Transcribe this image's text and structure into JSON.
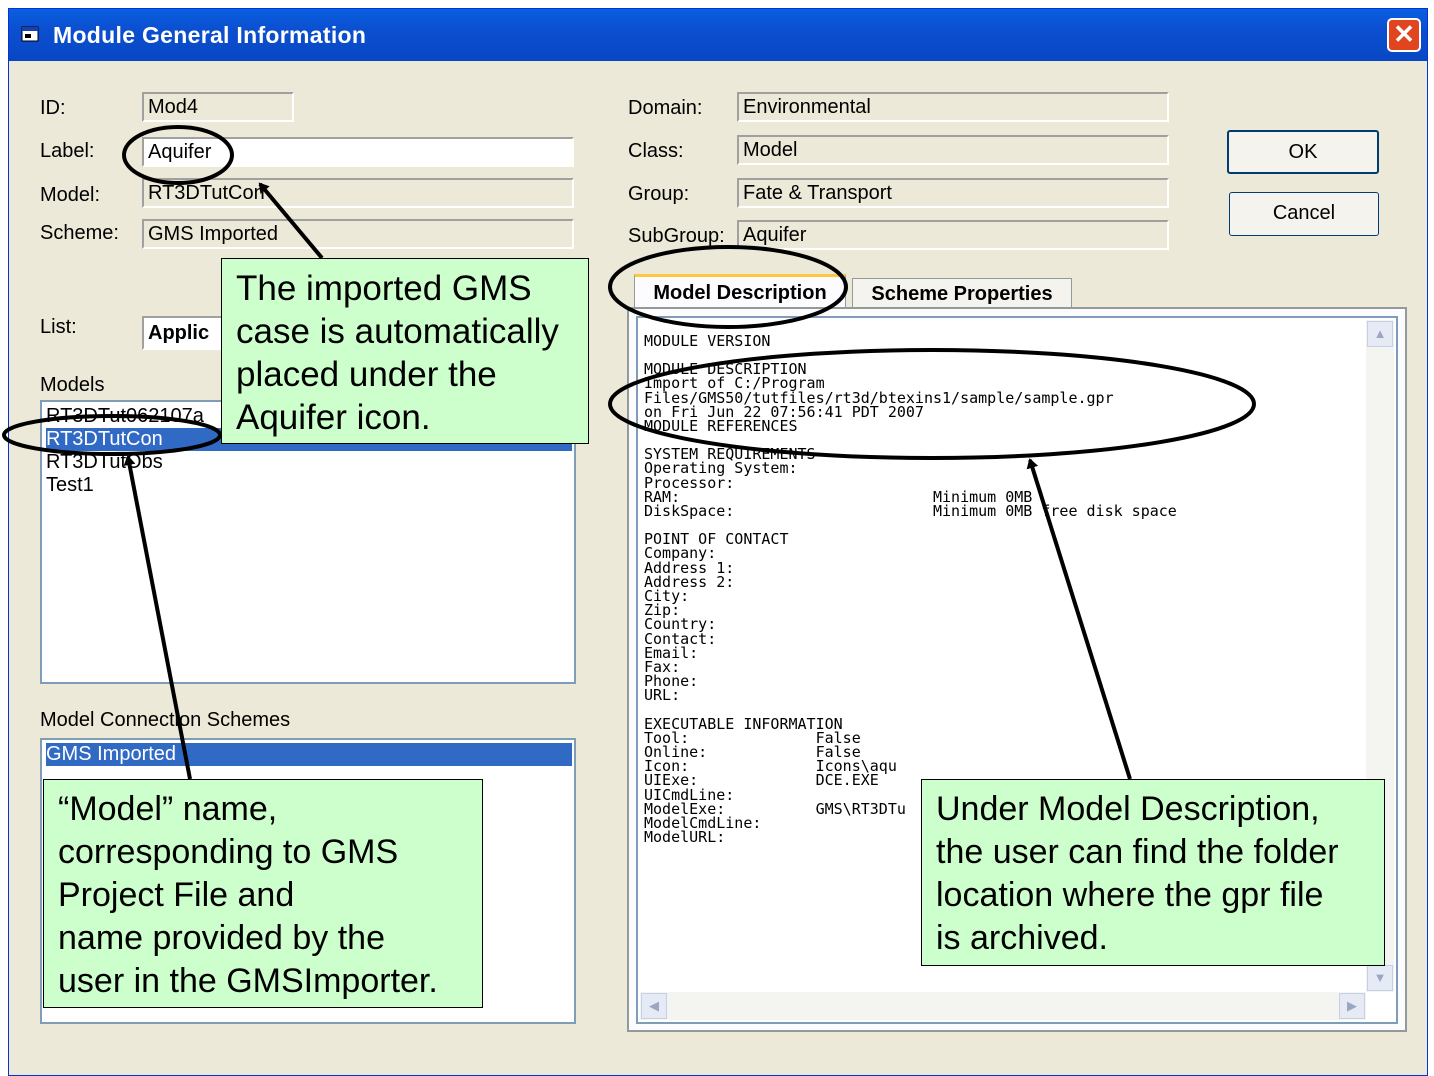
{
  "window": {
    "title": "Module General Information",
    "close_glyph": "✕"
  },
  "left_fields": [
    {
      "label": "ID:",
      "value": "Mod4"
    },
    {
      "label": "Label:",
      "value": "Aquifer"
    },
    {
      "label": "Model:",
      "value": "RT3DTutCon"
    },
    {
      "label": "Scheme:",
      "value": "GMS Imported"
    }
  ],
  "list": {
    "label": "List:",
    "value": "Applic"
  },
  "models": {
    "label": "Models",
    "items": [
      "RT3DTut062107a",
      "RT3DTutCon",
      "RT3DTutObs",
      "Test1"
    ],
    "selected_index": 1
  },
  "schemes": {
    "label": "Model Connection Schemes",
    "items": [
      "GMS Imported"
    ],
    "selected_index": 0
  },
  "right_fields": [
    {
      "label": "Domain:",
      "value": "Environmental"
    },
    {
      "label": "Class:",
      "value": "Model"
    },
    {
      "label": "Group:",
      "value": "Fate & Transport"
    },
    {
      "label": "SubGroup:",
      "value": "Aquifer"
    }
  ],
  "buttons": {
    "ok": "OK",
    "cancel": "Cancel"
  },
  "tabs": [
    {
      "label": "Model Description",
      "active": true
    },
    {
      "label": "Scheme Properties",
      "active": false
    }
  ],
  "description_lines": [
    {
      "text": "MODULE VERSION",
      "gap_before": 0
    },
    {
      "text": "MODULE DESCRIPTION",
      "gap_before": 1
    },
    {
      "text": "Import of C:/Program",
      "gap_before": 0
    },
    {
      "text": "Files/GMS50/tutfiles/rt3d/btexins1/sample/sample.gpr",
      "gap_before": 0
    },
    {
      "text": "on Fri Jun 22 07:56:41 PDT 2007",
      "gap_before": 0
    },
    {
      "text": "MODULE REFERENCES",
      "gap_before": 0
    },
    {
      "text": "SYSTEM REQUIREMENTS",
      "gap_before": 1
    },
    {
      "text": "Operating System:",
      "gap_before": 0
    },
    {
      "text": "Processor:",
      "gap_before": 0
    },
    {
      "text": "RAM:                            Minimum 0MB",
      "gap_before": 0
    },
    {
      "text": "DiskSpace:                      Minimum 0MB free disk space",
      "gap_before": 0
    },
    {
      "text": "POINT OF CONTACT",
      "gap_before": 1
    },
    {
      "text": "Company:",
      "gap_before": 0
    },
    {
      "text": "Address 1:",
      "gap_before": 0
    },
    {
      "text": "Address 2:",
      "gap_before": 0
    },
    {
      "text": "City:",
      "gap_before": 0
    },
    {
      "text": "Zip:",
      "gap_before": 0
    },
    {
      "text": "Country:",
      "gap_before": 0
    },
    {
      "text": "Contact:",
      "gap_before": 0
    },
    {
      "text": "Email:",
      "gap_before": 0
    },
    {
      "text": "Fax:",
      "gap_before": 0
    },
    {
      "text": "Phone:",
      "gap_before": 0
    },
    {
      "text": "URL:",
      "gap_before": 0
    },
    {
      "text": "EXECUTABLE INFORMATION",
      "gap_before": 1
    },
    {
      "text": "Tool:              False",
      "gap_before": 0
    },
    {
      "text": "Online:            False",
      "gap_before": 0
    },
    {
      "text": "Icon:              Icons\\aqu",
      "gap_before": 0
    },
    {
      "text": "UIExe:             DCE.EXE",
      "gap_before": 0
    },
    {
      "text": "UICmdLine:",
      "gap_before": 0
    },
    {
      "text": "ModelExe:          GMS\\RT3DTu",
      "gap_before": 0
    },
    {
      "text": "ModelCmdLine:",
      "gap_before": 0
    },
    {
      "text": "ModelURL:",
      "gap_before": 0
    }
  ],
  "callouts": {
    "top": [
      "The imported GMS",
      "case is automatically",
      "placed under the",
      "Aquifer icon."
    ],
    "bottom_left": [
      "“Model” name,",
      "corresponding to GMS",
      "Project File and",
      "name provided by the",
      "user in the GMSImporter."
    ],
    "bottom_right": [
      "Under Model Description,",
      "the user can find the folder",
      "location where the gpr file",
      "is archived."
    ]
  },
  "colors": {
    "titlebar": "#0b4fd0",
    "dialog_bg": "#ece9d8",
    "selection": "#316ac5",
    "callout_bg": "#ccffcc",
    "close_button": "#e0451f"
  }
}
